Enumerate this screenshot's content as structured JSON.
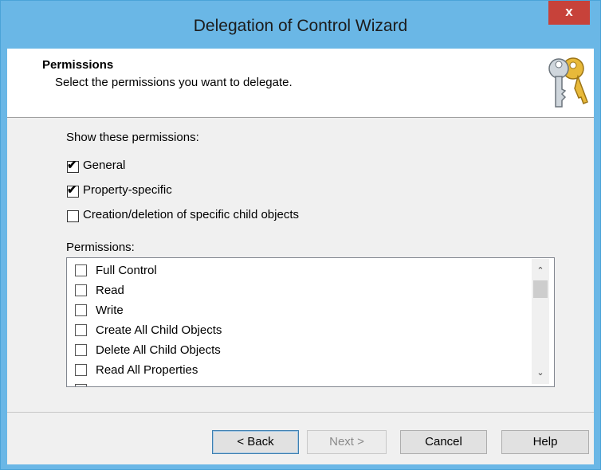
{
  "window": {
    "title": "Delegation of Control Wizard",
    "close_label": "x"
  },
  "header": {
    "title": "Permissions",
    "subtitle": "Select the permissions you want to delegate.",
    "icon": "keys-icon"
  },
  "filters": {
    "label": "Show these permissions:",
    "options": [
      {
        "label": "General",
        "checked": true
      },
      {
        "label": "Property-specific",
        "checked": true
      },
      {
        "label": "Creation/deletion of specific child objects",
        "checked": false
      }
    ]
  },
  "permissions": {
    "label": "Permissions:",
    "items": [
      {
        "label": "Full Control",
        "checked": false
      },
      {
        "label": "Read",
        "checked": false
      },
      {
        "label": "Write",
        "checked": false
      },
      {
        "label": "Create All Child Objects",
        "checked": false
      },
      {
        "label": "Delete All Child Objects",
        "checked": false
      },
      {
        "label": "Read All Properties",
        "checked": false
      }
    ],
    "scroll_up_icon": "chevron-up-icon",
    "scroll_down_icon": "chevron-down-icon"
  },
  "buttons": {
    "back": "< Back",
    "next": "Next >",
    "cancel": "Cancel",
    "help": "Help"
  },
  "colors": {
    "titlebar": "#6ab7e6",
    "close": "#c7423a"
  }
}
